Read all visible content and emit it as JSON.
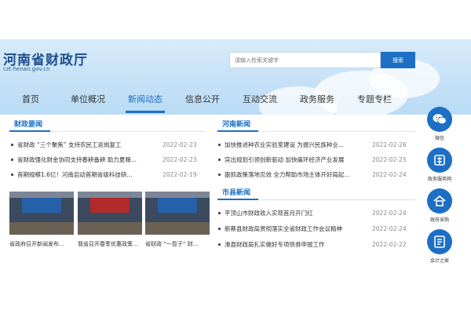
{
  "header": {
    "site_title": "河南省财政厅",
    "site_domain": "czt.henan.gov.cn",
    "search_placeholder": "请输入检索关键字",
    "search_button": "搜索"
  },
  "nav": {
    "items": [
      {
        "label": "首页"
      },
      {
        "label": "单位概况"
      },
      {
        "label": "新闻动态"
      },
      {
        "label": "信息公开"
      },
      {
        "label": "互动交流"
      },
      {
        "label": "政务服务"
      },
      {
        "label": "专题专栏"
      }
    ],
    "active_index": 2
  },
  "finance_news": {
    "title": "财政要闻",
    "items": [
      {
        "title": "省财政 “三个聚焦” 支持农民工返岗复工",
        "date": "2022-02-23"
      },
      {
        "title": "省财政强化财金协同支持春耕备耕 助力夏粮...",
        "date": "2022-02-23"
      },
      {
        "title": "首期规模1.6亿！河南启动首期省级科技研...",
        "date": "2022-02-19"
      }
    ],
    "photos": [
      {
        "caption": "省政府召开新闻发布..."
      },
      {
        "caption": "我省召开春季优惠政策..."
      },
      {
        "caption": "省财政 “一揽子” 财..."
      }
    ]
  },
  "henan_news": {
    "title": "河南新闻",
    "items": [
      {
        "title": "加快推进种农业实验室建设 为振兴民族种业...",
        "date": "2022-02-26"
      },
      {
        "title": "突出规划引领创新驱动 加快痛环经济产业发展",
        "date": "2022-02-25"
      },
      {
        "title": "狠抓政策落地见效 全力帮助市场主体开好局起...",
        "date": "2022-02-24"
      }
    ]
  },
  "county_news": {
    "title": "市县新闻",
    "items": [
      {
        "title": "平顶山市财政收入实现首月开门红",
        "date": "2022-02-24"
      },
      {
        "title": "新蔡县财政局贯彻落实全省财政工作会议精神",
        "date": "2022-02-24"
      },
      {
        "title": "滑县财政局扎实做好专项债券申报工作",
        "date": "2022-02-22"
      }
    ]
  },
  "side_menu": {
    "items": [
      {
        "label": "微信",
        "icon": "wechat-icon"
      },
      {
        "label": "政务服务网",
        "icon": "service-icon"
      },
      {
        "label": "政府采购",
        "icon": "house-icon"
      },
      {
        "label": "会计之家",
        "icon": "accounting-icon"
      }
    ]
  },
  "colors": {
    "brand_blue": "#1c6fc4",
    "title_blue": "#1c4f8e",
    "header_sky": "#c6e1f6"
  }
}
